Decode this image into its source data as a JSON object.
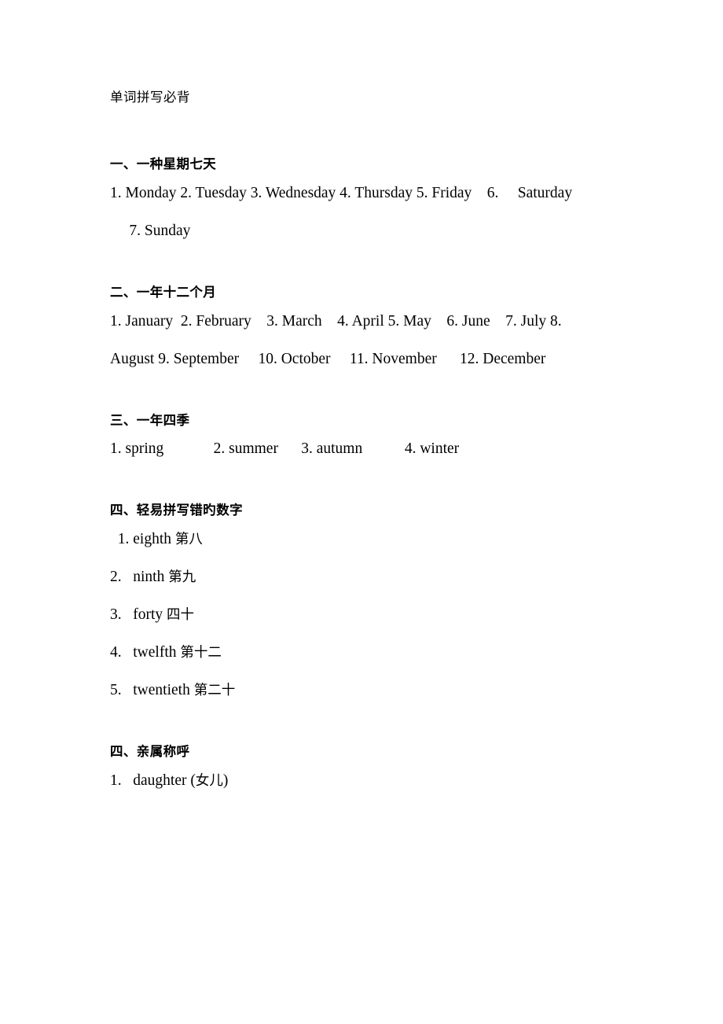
{
  "document": {
    "title": "单词拼写必背",
    "sections": [
      {
        "heading": "一、一种星期七天",
        "lines": [
          "1. Monday 2. Tuesday 3. Wednesday 4. Thursday 5. Friday    6.     Saturday",
          "     7. Sunday"
        ]
      },
      {
        "heading": "二、一年十二个月",
        "lines": [
          "1. January  2. February    3. March    4. April 5. May    6. June    7. July 8.",
          "August 9. September     10. October     11. November      12. December"
        ]
      },
      {
        "heading": "三、一年四季",
        "lines": [
          "1. spring             2. summer      3. autumn           4. winter"
        ]
      },
      {
        "heading": "四、轻易拼写错旳数字",
        "items": [
          {
            "num": "  1.",
            "en": " eighth ",
            "cn": "第八"
          },
          {
            "num": "2.",
            "en": "   ninth ",
            "cn": "第九"
          },
          {
            "num": "3.",
            "en": "   forty ",
            "cn": "四十"
          },
          {
            "num": "4.",
            "en": "   twelfth ",
            "cn": "第十二"
          },
          {
            "num": "5.",
            "en": "   twentieth ",
            "cn": "第二十"
          }
        ]
      },
      {
        "heading": "四、亲属称呼",
        "items": [
          {
            "num": "1.",
            "en": "   daughter (",
            "cn": "女儿",
            "suffix": ")"
          }
        ]
      }
    ]
  }
}
